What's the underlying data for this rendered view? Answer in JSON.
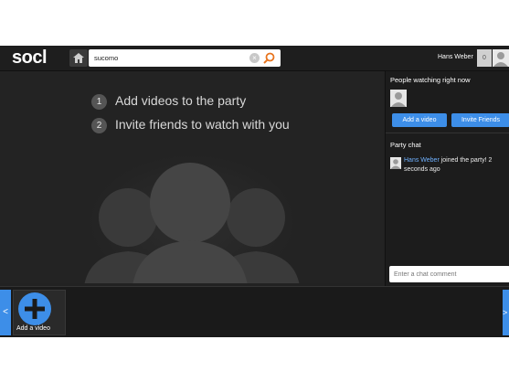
{
  "brand": {
    "logo_text": "socl"
  },
  "header": {
    "search_value": "sucomo",
    "user_name": "Hans Weber",
    "notification_count": "0"
  },
  "stage": {
    "steps": [
      {
        "num": "1",
        "text": "Add videos to the party"
      },
      {
        "num": "2",
        "text": "Invite friends to watch with you"
      }
    ],
    "progress": 0.01
  },
  "panel": {
    "watching_heading": "People watching right now",
    "add_video_label": "Add a video",
    "invite_label": "Invite Friends",
    "chat_heading": "Party chat",
    "chat_messages": [
      {
        "user": "Hans Weber",
        "text": " joined the party! 2 seconds ago"
      }
    ],
    "chat_placeholder": "Enter a chat comment"
  },
  "strip": {
    "prev_label": "<",
    "next_label": ">",
    "add_tile_label": "Add a video"
  },
  "colors": {
    "accent": "#3d8ee8",
    "link": "#6fb1ff",
    "background": "#222222"
  },
  "icons": [
    "home-icon",
    "clear-icon",
    "search-icon",
    "avatar-icon",
    "plus-icon"
  ]
}
